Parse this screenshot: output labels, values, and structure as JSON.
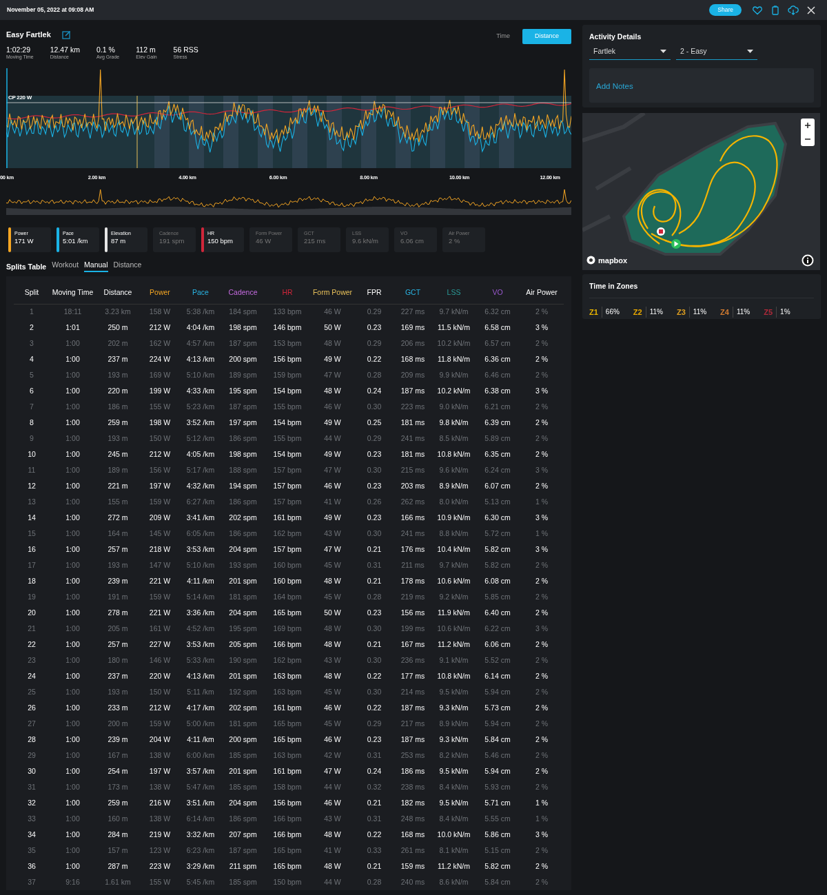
{
  "header": {
    "date": "November 05, 2022 at 09:08 AM",
    "share": "Share"
  },
  "activity": {
    "title": "Easy Fartlek",
    "stats": [
      {
        "value": "1:02:29",
        "label": "Moving Time"
      },
      {
        "value": "12.47 km",
        "label": "Distance"
      },
      {
        "value": "0.1 %",
        "label": "Avg Grade"
      },
      {
        "value": "112 m",
        "label": "Elev Gain"
      },
      {
        "value": "56 RSS",
        "label": "Stress"
      }
    ]
  },
  "view_toggle": [
    {
      "label": "Time",
      "selected": false
    },
    {
      "label": "Distance",
      "selected": true
    }
  ],
  "chart": {
    "cp_label": "CP 220 W",
    "x_labels": [
      "00 km",
      "2.00 km",
      "4.00 km",
      "6.00 km",
      "8.00 km",
      "10.00 km",
      "12.00 km"
    ]
  },
  "metrics": [
    {
      "label": "Power",
      "value": "171 W",
      "selected": true,
      "color": "#f5a623"
    },
    {
      "label": "Pace",
      "value": "5:01 /km",
      "selected": true,
      "color": "#1ab3e6"
    },
    {
      "label": "Elevation",
      "value": "87 m",
      "selected": true,
      "color": "#e6e6e6"
    },
    {
      "label": "Cadence",
      "value": "191 spm",
      "selected": false
    },
    {
      "label": "HR",
      "value": "150 bpm",
      "selected": true,
      "color": "#d0263a"
    },
    {
      "label": "Form Power",
      "value": "46 W",
      "selected": false
    },
    {
      "label": "GCT",
      "value": "215 ms",
      "selected": false
    },
    {
      "label": "LSS",
      "value": "9.6 kN/m",
      "selected": false
    },
    {
      "label": "VO",
      "value": "6.06 cm",
      "selected": false
    },
    {
      "label": "Air Power",
      "value": "2 %",
      "selected": false
    }
  ],
  "splits": {
    "title": "Splits Table",
    "tabs": [
      {
        "label": "Workout",
        "selected": false
      },
      {
        "label": "Manual",
        "selected": true
      },
      {
        "label": "Distance",
        "selected": false
      }
    ]
  },
  "table": {
    "columns": [
      {
        "label": "Split"
      },
      {
        "label": "Moving Time"
      },
      {
        "label": "Distance"
      },
      {
        "label": "Power",
        "color": "#f5a623"
      },
      {
        "label": "Pace",
        "color": "#29b6e6"
      },
      {
        "label": "Cadence",
        "color": "#c56be0"
      },
      {
        "label": "HR",
        "color": "#d0263a"
      },
      {
        "label": "Form Power",
        "color": "#e8c05a"
      },
      {
        "label": "FPR"
      },
      {
        "label": "GCT",
        "color": "#29b6e6"
      },
      {
        "label": "LSS",
        "color": "#2a9d9a"
      },
      {
        "label": "VO",
        "color": "#9b59d0"
      },
      {
        "label": "Air Power"
      }
    ],
    "rows": [
      {
        "dimmed": true,
        "cells": [
          "1",
          "18:11",
          "3.23 km",
          "158 W",
          "5:38 /km",
          "184 spm",
          "133 bpm",
          "46 W",
          "0.29",
          "227 ms",
          "9.7 kN/m",
          "6.32 cm",
          "2 %"
        ]
      },
      {
        "dimmed": false,
        "cells": [
          "2",
          "1:01",
          "250 m",
          "212 W",
          "4:04 /km",
          "198 spm",
          "146 bpm",
          "50 W",
          "0.23",
          "169 ms",
          "11.5 kN/m",
          "6.58 cm",
          "3 %"
        ]
      },
      {
        "dimmed": true,
        "cells": [
          "3",
          "1:00",
          "202 m",
          "162 W",
          "4:57 /km",
          "187 spm",
          "153 bpm",
          "48 W",
          "0.29",
          "206 ms",
          "10.2 kN/m",
          "6.57 cm",
          "2 %"
        ]
      },
      {
        "dimmed": false,
        "cells": [
          "4",
          "1:00",
          "237 m",
          "224 W",
          "4:13 /km",
          "200 spm",
          "156 bpm",
          "49 W",
          "0.22",
          "168 ms",
          "11.8 kN/m",
          "6.36 cm",
          "2 %"
        ]
      },
      {
        "dimmed": true,
        "cells": [
          "5",
          "1:00",
          "193 m",
          "169 W",
          "5:10 /km",
          "189 spm",
          "159 bpm",
          "47 W",
          "0.28",
          "209 ms",
          "9.9 kN/m",
          "6.46 cm",
          "2 %"
        ]
      },
      {
        "dimmed": false,
        "cells": [
          "6",
          "1:00",
          "220 m",
          "199 W",
          "4:33 /km",
          "195 spm",
          "154 bpm",
          "48 W",
          "0.24",
          "187 ms",
          "10.2 kN/m",
          "6.38 cm",
          "3 %"
        ]
      },
      {
        "dimmed": true,
        "cells": [
          "7",
          "1:00",
          "186 m",
          "155 W",
          "5:23 /km",
          "187 spm",
          "155 bpm",
          "46 W",
          "0.30",
          "223 ms",
          "9.0 kN/m",
          "6.21 cm",
          "2 %"
        ]
      },
      {
        "dimmed": false,
        "cells": [
          "8",
          "1:00",
          "259 m",
          "198 W",
          "3:52 /km",
          "197 spm",
          "154 bpm",
          "49 W",
          "0.25",
          "181 ms",
          "9.8 kN/m",
          "6.39 cm",
          "2 %"
        ]
      },
      {
        "dimmed": true,
        "cells": [
          "9",
          "1:00",
          "193 m",
          "150 W",
          "5:12 /km",
          "186 spm",
          "155 bpm",
          "44 W",
          "0.29",
          "241 ms",
          "8.5 kN/m",
          "5.89 cm",
          "2 %"
        ]
      },
      {
        "dimmed": false,
        "cells": [
          "10",
          "1:00",
          "245 m",
          "212 W",
          "4:05 /km",
          "198 spm",
          "154 bpm",
          "49 W",
          "0.23",
          "181 ms",
          "10.8 kN/m",
          "6.35 cm",
          "2 %"
        ]
      },
      {
        "dimmed": true,
        "cells": [
          "11",
          "1:00",
          "189 m",
          "156 W",
          "5:17 /km",
          "188 spm",
          "157 bpm",
          "47 W",
          "0.30",
          "215 ms",
          "9.6 kN/m",
          "6.24 cm",
          "3 %"
        ]
      },
      {
        "dimmed": false,
        "cells": [
          "12",
          "1:00",
          "221 m",
          "197 W",
          "4:32 /km",
          "194 spm",
          "157 bpm",
          "46 W",
          "0.23",
          "203 ms",
          "8.9 kN/m",
          "6.07 cm",
          "2 %"
        ]
      },
      {
        "dimmed": true,
        "cells": [
          "13",
          "1:00",
          "155 m",
          "159 W",
          "6:27 /km",
          "186 spm",
          "157 bpm",
          "41 W",
          "0.26",
          "262 ms",
          "8.0 kN/m",
          "5.13 cm",
          "1 %"
        ]
      },
      {
        "dimmed": false,
        "cells": [
          "14",
          "1:00",
          "272 m",
          "209 W",
          "3:41 /km",
          "202 spm",
          "161 bpm",
          "49 W",
          "0.23",
          "166 ms",
          "10.9 kN/m",
          "6.30 cm",
          "3 %"
        ]
      },
      {
        "dimmed": true,
        "cells": [
          "15",
          "1:00",
          "164 m",
          "145 W",
          "6:05 /km",
          "186 spm",
          "162 bpm",
          "43 W",
          "0.30",
          "241 ms",
          "8.8 kN/m",
          "5.72 cm",
          "1 %"
        ]
      },
      {
        "dimmed": false,
        "cells": [
          "16",
          "1:00",
          "257 m",
          "218 W",
          "3:53 /km",
          "204 spm",
          "157 bpm",
          "47 W",
          "0.21",
          "176 ms",
          "10.4 kN/m",
          "5.82 cm",
          "3 %"
        ]
      },
      {
        "dimmed": true,
        "cells": [
          "17",
          "1:00",
          "193 m",
          "147 W",
          "5:10 /km",
          "193 spm",
          "160 bpm",
          "45 W",
          "0.31",
          "211 ms",
          "9.7 kN/m",
          "5.82 cm",
          "2 %"
        ]
      },
      {
        "dimmed": false,
        "cells": [
          "18",
          "1:00",
          "239 m",
          "221 W",
          "4:11 /km",
          "201 spm",
          "160 bpm",
          "48 W",
          "0.21",
          "178 ms",
          "10.6 kN/m",
          "6.08 cm",
          "2 %"
        ]
      },
      {
        "dimmed": true,
        "cells": [
          "19",
          "1:00",
          "191 m",
          "159 W",
          "5:14 /km",
          "181 spm",
          "164 bpm",
          "45 W",
          "0.28",
          "219 ms",
          "9.2 kN/m",
          "5.85 cm",
          "2 %"
        ]
      },
      {
        "dimmed": false,
        "cells": [
          "20",
          "1:00",
          "278 m",
          "221 W",
          "3:36 /km",
          "204 spm",
          "165 bpm",
          "50 W",
          "0.23",
          "156 ms",
          "11.9 kN/m",
          "6.40 cm",
          "2 %"
        ]
      },
      {
        "dimmed": true,
        "cells": [
          "21",
          "1:00",
          "205 m",
          "161 W",
          "4:52 /km",
          "195 spm",
          "169 bpm",
          "48 W",
          "0.30",
          "199 ms",
          "10.6 kN/m",
          "6.22 cm",
          "3 %"
        ]
      },
      {
        "dimmed": false,
        "cells": [
          "22",
          "1:00",
          "257 m",
          "227 W",
          "3:53 /km",
          "205 spm",
          "166 bpm",
          "48 W",
          "0.21",
          "167 ms",
          "11.2 kN/m",
          "6.06 cm",
          "2 %"
        ]
      },
      {
        "dimmed": true,
        "cells": [
          "23",
          "1:00",
          "180 m",
          "146 W",
          "5:33 /km",
          "190 spm",
          "162 bpm",
          "43 W",
          "0.30",
          "236 ms",
          "9.1 kN/m",
          "5.52 cm",
          "2 %"
        ]
      },
      {
        "dimmed": false,
        "cells": [
          "24",
          "1:00",
          "237 m",
          "220 W",
          "4:13 /km",
          "201 spm",
          "163 bpm",
          "48 W",
          "0.22",
          "177 ms",
          "10.8 kN/m",
          "6.14 cm",
          "2 %"
        ]
      },
      {
        "dimmed": true,
        "cells": [
          "25",
          "1:00",
          "193 m",
          "150 W",
          "5:11 /km",
          "192 spm",
          "163 bpm",
          "45 W",
          "0.30",
          "214 ms",
          "9.5 kN/m",
          "5.94 cm",
          "2 %"
        ]
      },
      {
        "dimmed": false,
        "cells": [
          "26",
          "1:00",
          "233 m",
          "212 W",
          "4:17 /km",
          "202 spm",
          "161 bpm",
          "46 W",
          "0.22",
          "187 ms",
          "9.3 kN/m",
          "5.73 cm",
          "2 %"
        ]
      },
      {
        "dimmed": true,
        "cells": [
          "27",
          "1:00",
          "200 m",
          "159 W",
          "5:00 /km",
          "181 spm",
          "165 bpm",
          "45 W",
          "0.29",
          "217 ms",
          "8.9 kN/m",
          "5.94 cm",
          "2 %"
        ]
      },
      {
        "dimmed": false,
        "cells": [
          "28",
          "1:00",
          "239 m",
          "204 W",
          "4:11 /km",
          "200 spm",
          "165 bpm",
          "46 W",
          "0.23",
          "187 ms",
          "9.3 kN/m",
          "5.84 cm",
          "2 %"
        ]
      },
      {
        "dimmed": true,
        "cells": [
          "29",
          "1:00",
          "167 m",
          "138 W",
          "6:00 /km",
          "185 spm",
          "163 bpm",
          "42 W",
          "0.31",
          "253 ms",
          "8.2 kN/m",
          "5.46 cm",
          "2 %"
        ]
      },
      {
        "dimmed": false,
        "cells": [
          "30",
          "1:00",
          "254 m",
          "197 W",
          "3:57 /km",
          "201 spm",
          "161 bpm",
          "47 W",
          "0.24",
          "186 ms",
          "9.5 kN/m",
          "5.94 cm",
          "2 %"
        ]
      },
      {
        "dimmed": true,
        "cells": [
          "31",
          "1:00",
          "173 m",
          "138 W",
          "5:47 /km",
          "185 spm",
          "158 bpm",
          "44 W",
          "0.32",
          "238 ms",
          "8.4 kN/m",
          "5.93 cm",
          "2 %"
        ]
      },
      {
        "dimmed": false,
        "cells": [
          "32",
          "1:00",
          "259 m",
          "216 W",
          "3:51 /km",
          "204 spm",
          "156 bpm",
          "46 W",
          "0.21",
          "182 ms",
          "9.5 kN/m",
          "5.71 cm",
          "1 %"
        ]
      },
      {
        "dimmed": true,
        "cells": [
          "33",
          "1:00",
          "160 m",
          "138 W",
          "6:14 /km",
          "186 spm",
          "166 bpm",
          "43 W",
          "0.31",
          "248 ms",
          "8.4 kN/m",
          "5.55 cm",
          "1 %"
        ]
      },
      {
        "dimmed": false,
        "cells": [
          "34",
          "1:00",
          "284 m",
          "219 W",
          "3:32 /km",
          "207 spm",
          "166 bpm",
          "48 W",
          "0.22",
          "168 ms",
          "10.0 kN/m",
          "5.86 cm",
          "3 %"
        ]
      },
      {
        "dimmed": true,
        "cells": [
          "35",
          "1:00",
          "157 m",
          "123 W",
          "6:23 /km",
          "187 spm",
          "165 bpm",
          "41 W",
          "0.33",
          "261 ms",
          "8.1 kN/m",
          "5.15 cm",
          "2 %"
        ]
      },
      {
        "dimmed": false,
        "cells": [
          "36",
          "1:00",
          "287 m",
          "223 W",
          "3:29 /km",
          "211 spm",
          "165 bpm",
          "48 W",
          "0.21",
          "159 ms",
          "11.2 kN/m",
          "5.82 cm",
          "2 %"
        ]
      },
      {
        "dimmed": true,
        "cells": [
          "37",
          "9:16",
          "1.61 km",
          "155 W",
          "5:45 /km",
          "185 spm",
          "150 bpm",
          "44 W",
          "0.28",
          "240 ms",
          "8.6 kN/m",
          "5.84 cm",
          "2 %"
        ]
      }
    ]
  },
  "activity_details": {
    "title": "Activity Details",
    "type": "Fartlek",
    "intensity": "2 - Easy",
    "notes_link": "Add Notes"
  },
  "map": {
    "attribution": "mapbox"
  },
  "zones": {
    "title": "Time in Zones",
    "items": [
      {
        "label": "Z1",
        "value": "66%",
        "color": "#e8b400"
      },
      {
        "label": "Z2",
        "value": "11%",
        "color": "#e8a800"
      },
      {
        "label": "Z3",
        "value": "11%",
        "color": "#e0a020"
      },
      {
        "label": "Z4",
        "value": "11%",
        "color": "#d07a30"
      },
      {
        "label": "Z5",
        "value": "1%",
        "color": "#b02a3a"
      }
    ]
  }
}
